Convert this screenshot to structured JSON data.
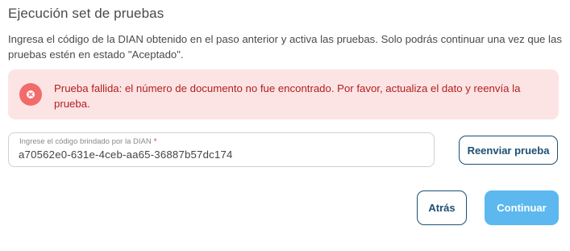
{
  "section": {
    "title": "Ejecución set de pruebas",
    "description": "Ingresa el código de la DIAN obtenido en el paso anterior y activa las pruebas. Solo podrás continuar una vez que las pruebas estén en estado \"Aceptado\"."
  },
  "alert": {
    "type": "error",
    "icon": "close-circle-icon",
    "message": "Prueba fallida: el número de documento no fue encontrado. Por favor, actualiza el dato y reenvía la prueba."
  },
  "code_field": {
    "label": "Ingrese el código brindado por la DIAN",
    "required_marker": "*",
    "value": "a70562e0-631e-4ceb-aa65-36887b57dc174"
  },
  "buttons": {
    "resend_label": "Reenviar prueba",
    "back_label": "Atrás",
    "continue_label": "Continuar"
  },
  "colors": {
    "alert_background": "#fde4e4",
    "alert_text": "#b02020",
    "alert_icon": "#f26b6b",
    "primary_outline": "#1d4f73",
    "continue_background": "#5cb8ef"
  }
}
